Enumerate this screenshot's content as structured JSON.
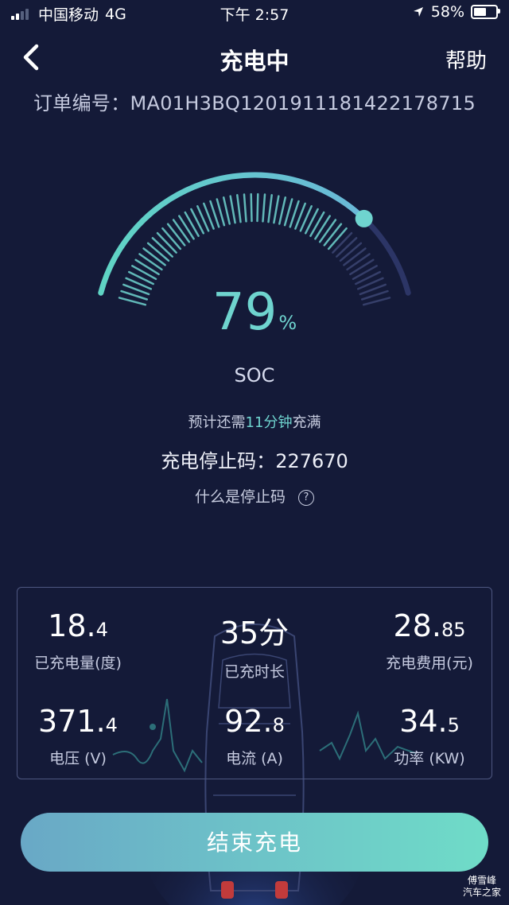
{
  "status_bar": {
    "carrier": "中国移动",
    "network": "4G",
    "time": "下午 2:57",
    "battery": "58%",
    "battery_level": 0.58,
    "signal_bars": 2,
    "location_icon": "location-arrow-icon"
  },
  "nav": {
    "back_icon": "chevron-left-icon",
    "title": "充电中",
    "help_label": "帮助"
  },
  "order": {
    "label": "订单编号：",
    "number": "MA01H3BQ1201911181422178715"
  },
  "gauge": {
    "soc_value": "79",
    "soc_unit": "%",
    "soc_fraction": 0.79,
    "soc_label": "SOC",
    "accent_color": "#6fd4cf",
    "track_color": "#2c3566"
  },
  "charging": {
    "remain_prefix": "预计还需",
    "remain_time": "11分钟",
    "remain_suffix": "充满",
    "stop_code_label": "充电停止码：",
    "stop_code": "227670",
    "what_is_label": "什么是停止码",
    "question_icon": "question-circle-icon",
    "question_glyph": "?"
  },
  "stats": [
    {
      "int": "18.",
      "dec": "4",
      "label": "已充电量(度)"
    },
    {
      "int": "35分",
      "dec": "",
      "label": "已充时长"
    },
    {
      "int": "28.",
      "dec": "85",
      "label": "充电费用(元)"
    },
    {
      "int": "371.",
      "dec": "4",
      "label": "电压 (V)"
    },
    {
      "int": "92.",
      "dec": "8",
      "label": "电流 (A)"
    },
    {
      "int": "34.",
      "dec": "5",
      "label": "功率 (KW)"
    }
  ],
  "actions": {
    "end_charge_label": "结束充电"
  },
  "watermark": {
    "line1": "傅雪峰",
    "line2": "汽车之家"
  }
}
